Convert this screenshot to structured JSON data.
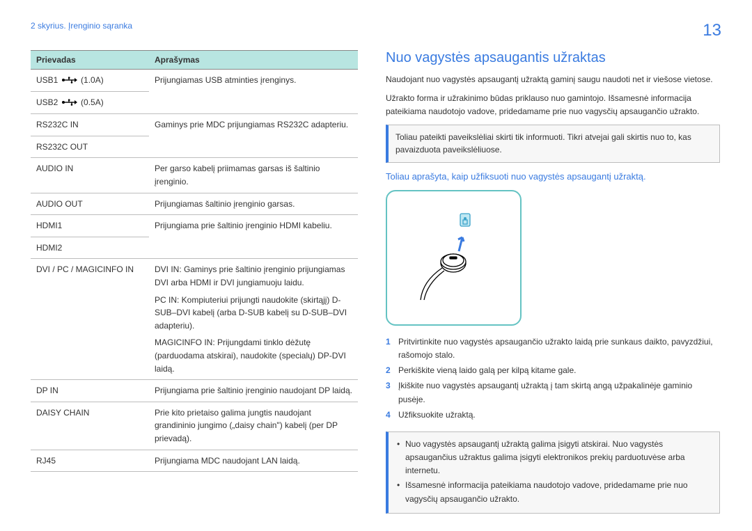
{
  "page_number": "13",
  "chapter_header": "2 skyrius. Įrenginio sąranka",
  "ports_table": {
    "header_port": "Prievadas",
    "header_desc": "Aprašymas",
    "rows": [
      {
        "port_prefix": "USB1",
        "port_suffix": "(1.0A)",
        "desc": "Prijungiamas USB atminties įrenginys."
      },
      {
        "port_prefix": "USB2",
        "port_suffix": "(0.5A)",
        "desc": ""
      },
      {
        "port": "RS232C IN",
        "desc": "Gaminys prie MDC prijungiamas RS232C adapteriu."
      },
      {
        "port": "RS232C OUT",
        "desc": ""
      },
      {
        "port": "AUDIO IN",
        "desc": "Per garso kabelį priimamas garsas iš šaltinio įrenginio."
      },
      {
        "port": "AUDIO OUT",
        "desc": "Prijungiamas šaltinio įrenginio garsas."
      },
      {
        "port": "HDMI1",
        "desc": "Prijungiama prie šaltinio įrenginio HDMI kabeliu."
      },
      {
        "port": "HDMI2",
        "desc": ""
      },
      {
        "port": "DVI / PC / MAGICINFO IN",
        "desc_multi": [
          "DVI IN: Gaminys prie šaltinio įrenginio prijungiamas DVI arba HDMI ir DVI jungiamuoju laidu.",
          "PC IN: Kompiuteriui prijungti naudokite (skirtąjį) D-SUB–DVI kabelį (arba D-SUB kabelį su D-SUB–DVI adapteriu).",
          "MAGICINFO IN: Prijungdami tinklo dėžutę (parduodama atskirai), naudokite (specialų) DP-DVI laidą."
        ]
      },
      {
        "port": "DP IN",
        "desc": "Prijungiama prie šaltinio įrenginio naudojant DP laidą."
      },
      {
        "port": "DAISY CHAIN",
        "desc": "Prie kito prietaiso galima jungtis naudojant grandininio jungimo („daisy chain\") kabelį (per DP prievadą)."
      },
      {
        "port": "RJ45",
        "desc": "Prijungiama MDC naudojant LAN laidą."
      }
    ]
  },
  "lock": {
    "title": "Nuo vagystės apsaugantis užraktas",
    "intro1": "Naudojant nuo vagystės apsaugantį užraktą gaminį saugu naudoti net ir viešose vietose.",
    "intro2": "Užrakto forma ir užrakinimo būdas priklauso nuo gamintojo. Išsamesnė informacija pateikiama naudotojo vadove, pridedamame prie nuo vagysčių apsaugančio užrakto.",
    "callout": "Toliau pateikti paveikslėliai skirti tik informuoti. Tikri atvejai gali skirtis nuo to, kas pavaizduota paveikslėliuose.",
    "subheading": "Toliau aprašyta, kaip užfiksuoti nuo vagystės apsaugantį užraktą.",
    "steps": [
      "Pritvirtinkite nuo vagystės apsaugančio užrakto laidą prie sunkaus daikto, pavyzdžiui, rašomojo stalo.",
      "Perkiškite vieną laido galą per kilpą kitame gale.",
      "Įkiškite nuo vagystės apsaugantį užraktą į tam skirtą angą užpakalinėje gaminio pusėje.",
      "Užfiksuokite užraktą."
    ],
    "notes": [
      "Nuo vagystės apsaugantį užraktą galima įsigyti atskirai. Nuo vagystės apsaugančius užraktus galima įsigyti elektronikos prekių parduotuvėse arba internetu.",
      "Išsamesnė informacija pateikiama naudotojo vadove, pridedamame prie nuo vagysčių apsaugančio užrakto."
    ]
  }
}
